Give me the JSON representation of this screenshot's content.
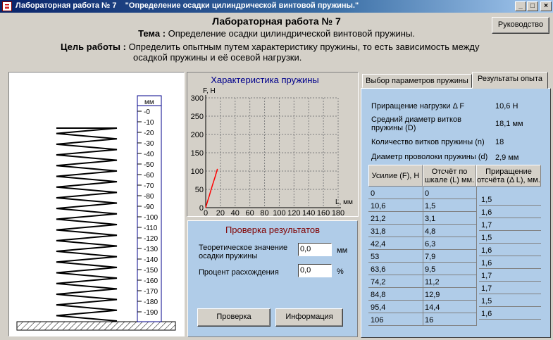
{
  "window": {
    "title": "Лабораторная работа № 7    \"Определение осадки цилиндрической винтовой пружины.\"",
    "minimize": "_",
    "maximize": "□",
    "close": "×"
  },
  "header": {
    "title": "Лабораторная работа № 7",
    "topic_label": "Тема :",
    "topic": "Определение осадки цилиндрической винтовой пружины.",
    "goal_label": "Цель работы :",
    "goal_line1": "Определить опытным путем характеристику пружины, то есть зависимость между",
    "goal_line2": "осадкой пружины и её осевой нагрузки."
  },
  "guide_button": "Руководство",
  "ruler": {
    "unit": "мм",
    "ticks": [
      "0",
      "10",
      "20",
      "30",
      "40",
      "50",
      "60",
      "70",
      "80",
      "90",
      "100",
      "110",
      "120",
      "130",
      "140",
      "150",
      "160",
      "170",
      "180",
      "190"
    ]
  },
  "chart_data": {
    "type": "line",
    "title": "Характеристика пружины",
    "ylabel": "F, Н",
    "xlabel": "L, мм",
    "xlim": [
      0,
      180
    ],
    "ylim": [
      0,
      300
    ],
    "x_ticks": [
      "0",
      "20",
      "40",
      "60",
      "80",
      "100",
      "120",
      "140",
      "160",
      "180"
    ],
    "y_ticks": [
      "0",
      "50",
      "100",
      "150",
      "200",
      "250",
      "300"
    ],
    "grid": true,
    "series": [
      {
        "color": "#ff0000",
        "x": [
          0,
          1.5,
          3.1,
          4.8,
          6.3,
          7.9,
          9.5,
          11.2,
          12.9,
          14.4,
          16
        ],
        "y": [
          0,
          10.6,
          21.2,
          31.8,
          42.4,
          53,
          63.6,
          74.2,
          84.8,
          95.4,
          106
        ]
      }
    ]
  },
  "check": {
    "title": "Проверка результатов",
    "theory_label_1": "Теоретическое значение",
    "theory_label_2": "осадки пружины",
    "theory_value": "0,0",
    "theory_unit": "мм",
    "diff_label": "Процент расхождения",
    "diff_value": "0,0",
    "diff_unit": "%",
    "check_button": "Проверка",
    "info_button": "Информация"
  },
  "tabs": {
    "tab1": "Выбор параметров пружины",
    "tab2": "Результаты опыта"
  },
  "results": {
    "load_inc_label": "Приращение нагрузки Δ F",
    "load_inc_value": "10,6 Н",
    "diameter_label_1": "Средний диаметр витков",
    "diameter_label_2": "пружины (D)",
    "diameter_value": "18,1 мм",
    "coils_label": "Количество витков пружины (n)",
    "coils_value": "18",
    "wire_label": "Диаметр проволоки пружины (d)",
    "wire_value": "2,9 мм",
    "col1": "Усилие (F), Н",
    "col2_1": "Отсчёт по",
    "col2_2": "шкале (L) мм.",
    "col3_1": "Приращение",
    "col3_2": "отсчёта (Δ L), мм.",
    "forces": [
      "0",
      "10,6",
      "21,2",
      "31,8",
      "42,4",
      "53",
      "63,6",
      "74,2",
      "84,8",
      "95,4",
      "106"
    ],
    "readings": [
      "0",
      "1,5",
      "3,1",
      "4,8",
      "6,3",
      "7,9",
      "9,5",
      "11,2",
      "12,9",
      "14,4",
      "16"
    ],
    "increments": [
      "1,5",
      "1,6",
      "1,7",
      "1,5",
      "1,6",
      "1,6",
      "1,7",
      "1,7",
      "1,5",
      "1,6"
    ]
  }
}
